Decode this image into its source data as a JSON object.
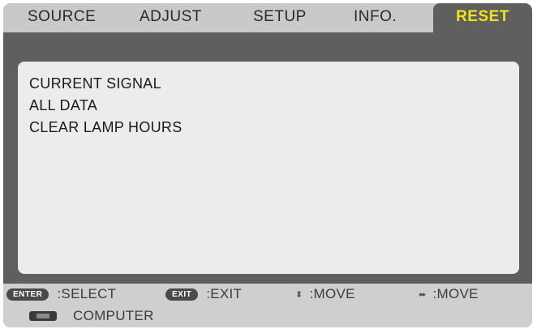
{
  "tabs": [
    {
      "label": "SOURCE"
    },
    {
      "label": "ADJUST"
    },
    {
      "label": "SETUP"
    },
    {
      "label": "INFO."
    },
    {
      "label": "RESET",
      "active": true
    }
  ],
  "menu": {
    "items": [
      {
        "label": "CURRENT SIGNAL"
      },
      {
        "label": "ALL DATA"
      },
      {
        "label": "CLEAR LAMP HOURS"
      }
    ]
  },
  "hints": {
    "enter_key": "ENTER",
    "enter_action": ":SELECT",
    "exit_key": "EXIT",
    "exit_action": ":EXIT",
    "updown_arrow": "⬍",
    "updown_action": ":MOVE",
    "leftright_arrow": "⬌",
    "leftright_action": ":MOVE"
  },
  "source": {
    "icon": "computer-icon",
    "label": "COMPUTER"
  },
  "colors": {
    "active_tab_text": "#f3e31a",
    "frame": "#5f5f5f",
    "panel": "#ececec"
  }
}
